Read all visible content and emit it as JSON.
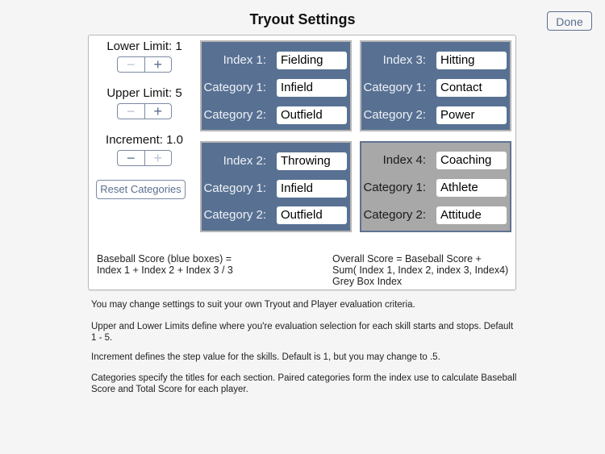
{
  "header": {
    "title": "Tryout Settings",
    "done_label": "Done"
  },
  "settings": {
    "lower_limit": {
      "label": "Lower Limit: 1",
      "minus": "−",
      "plus": "+",
      "minus_enabled": false,
      "plus_enabled": true
    },
    "upper_limit": {
      "label": "Upper Limit: 5",
      "minus": "−",
      "plus": "+",
      "minus_enabled": false,
      "plus_enabled": true
    },
    "increment": {
      "label": "Increment: 1.0",
      "minus": "−",
      "plus": "+",
      "minus_enabled": true,
      "plus_enabled": false
    },
    "reset_label": "Reset Categories"
  },
  "boxes": [
    {
      "color": "blue",
      "index_label": "Index 1:",
      "index_value": "Fielding",
      "cat1_label": "Category 1:",
      "cat1_value": "Infield",
      "cat2_label": "Category 2:",
      "cat2_value": "Outfield"
    },
    {
      "color": "blue",
      "index_label": "Index 2:",
      "index_value": "Throwing",
      "cat1_label": "Category 1:",
      "cat1_value": "Infield",
      "cat2_label": "Category 2:",
      "cat2_value": "Outfield"
    },
    {
      "color": "blue",
      "index_label": "Index 3:",
      "index_value": "Hitting",
      "cat1_label": "Category 1:",
      "cat1_value": "Contact",
      "cat2_label": "Category 2:",
      "cat2_value": "Power"
    },
    {
      "color": "grey",
      "index_label": "Index 4:",
      "index_value": "Coaching",
      "cat1_label": "Category 1:",
      "cat1_value": "Athlete",
      "cat2_label": "Category 2:",
      "cat2_value": "Attitude"
    }
  ],
  "formulas": {
    "baseball_line1": "Baseball Score (blue boxes) =",
    "baseball_line2": "Index 1 + Index 2 + Index 3 / 3",
    "overall_line1": "Overall Score = Baseball Score +",
    "overall_line2": "Sum( Index 1, Index 2, index 3, Index4)",
    "overall_line3": "Grey Box Index"
  },
  "help": {
    "p1": "You may change settings to suit your own Tryout and Player evaluation criteria.",
    "p2": "Upper and Lower Limits define where you're evaluation selection for each skill starts and stops. Default 1 - 5.",
    "p3": "Increment defines the step value for the skills. Default is 1, but you may change to .5.",
    "p4": "Categories specify the titles for each section. Paired categories form the index use to calculate Baseball Score and Total Score for each player."
  },
  "colors": {
    "blue_box": "#587193",
    "grey_box": "#a8a8a8",
    "accent": "#5a6e8e"
  }
}
